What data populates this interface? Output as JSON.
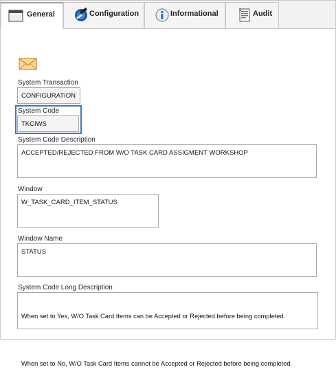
{
  "tabs": [
    {
      "label": "General",
      "icon": "window-icon",
      "active": true
    },
    {
      "label": "Configuration",
      "icon": "configuration-icon",
      "active": false
    },
    {
      "label": "Informational",
      "icon": "info-icon",
      "active": false
    },
    {
      "label": "Audit",
      "icon": "audit-icon",
      "active": false
    }
  ],
  "form": {
    "system_transaction": {
      "label": "System Transaction",
      "value": "CONFIGURATION"
    },
    "system_code": {
      "label": "System Code",
      "value": "TKCIWS"
    },
    "system_code_description": {
      "label": "System Code Description",
      "value": "ACCEPTED/REJECTED FROM W/O TASK CARD ASSIGMENT WORKSHOP"
    },
    "window": {
      "label": "Window",
      "value": "W_TASK_CARD_ITEM_STATUS"
    },
    "window_name": {
      "label": "Window Name",
      "value": "STATUS"
    },
    "long_description": {
      "label": "System Code Long Description",
      "line1": "When set to Yes, W/O Task Card Items can be Accepted or Rejected before being completed.",
      "line2": "When set to No, W/O Task Card Items cannot be Accepted or Rejected before being completed."
    }
  },
  "colors": {
    "accent": "#3d79b8",
    "mail_icon": "#e8a33a"
  }
}
